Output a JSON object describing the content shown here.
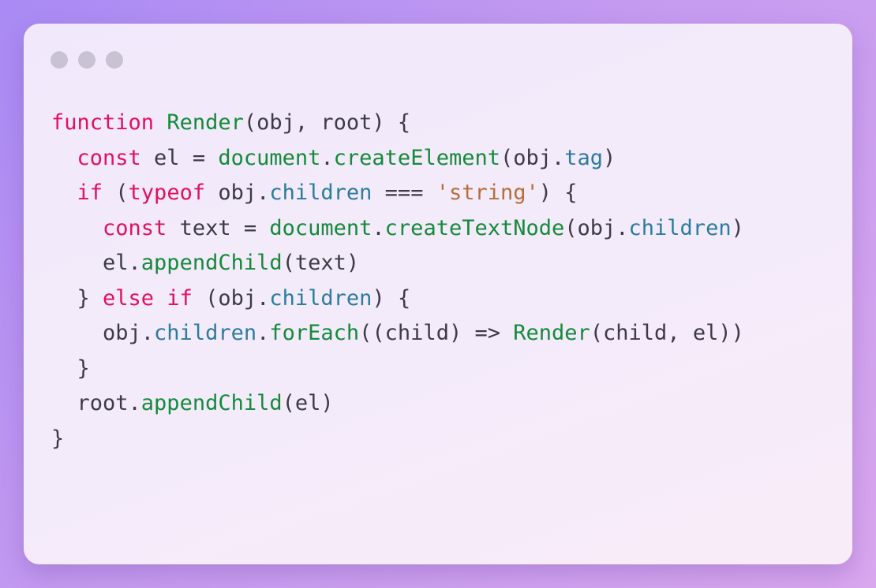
{
  "window": {
    "controls": [
      "window-dot-1",
      "window-dot-2",
      "window-dot-3"
    ]
  },
  "colors": {
    "keyword": "#e0115e",
    "function": "#148a3a",
    "property": "#2b7c9c",
    "string": "#b86e36",
    "plain": "#3d3a45",
    "background": "#f1e9fb"
  },
  "code": {
    "lines": [
      [
        [
          "kw",
          "function"
        ],
        [
          "plain",
          " "
        ],
        [
          "fn",
          "Render"
        ],
        [
          "plain",
          "(obj, root) {"
        ]
      ],
      [
        [
          "plain",
          "  "
        ],
        [
          "kw",
          "const"
        ],
        [
          "plain",
          " el = "
        ],
        [
          "fn",
          "document"
        ],
        [
          "plain",
          "."
        ],
        [
          "fn",
          "createElement"
        ],
        [
          "plain",
          "(obj."
        ],
        [
          "prop",
          "tag"
        ],
        [
          "plain",
          ")"
        ]
      ],
      [
        [
          "plain",
          "  "
        ],
        [
          "kw",
          "if"
        ],
        [
          "plain",
          " ("
        ],
        [
          "kw",
          "typeof"
        ],
        [
          "plain",
          " obj."
        ],
        [
          "prop",
          "children"
        ],
        [
          "plain",
          " === "
        ],
        [
          "str",
          "'string'"
        ],
        [
          "plain",
          ") {"
        ]
      ],
      [
        [
          "plain",
          "    "
        ],
        [
          "kw",
          "const"
        ],
        [
          "plain",
          " text = "
        ],
        [
          "fn",
          "document"
        ],
        [
          "plain",
          "."
        ],
        [
          "fn",
          "createTextNode"
        ],
        [
          "plain",
          "(obj."
        ],
        [
          "prop",
          "children"
        ],
        [
          "plain",
          ")"
        ]
      ],
      [
        [
          "plain",
          "    el."
        ],
        [
          "fn",
          "appendChild"
        ],
        [
          "plain",
          "(text)"
        ]
      ],
      [
        [
          "plain",
          "  } "
        ],
        [
          "kw",
          "else"
        ],
        [
          "plain",
          " "
        ],
        [
          "kw",
          "if"
        ],
        [
          "plain",
          " (obj."
        ],
        [
          "prop",
          "children"
        ],
        [
          "plain",
          ") {"
        ]
      ],
      [
        [
          "plain",
          "    obj."
        ],
        [
          "prop",
          "children"
        ],
        [
          "plain",
          "."
        ],
        [
          "fn",
          "forEach"
        ],
        [
          "plain",
          "((child) => "
        ],
        [
          "fn",
          "Render"
        ],
        [
          "plain",
          "(child, el))"
        ]
      ],
      [
        [
          "plain",
          "  }"
        ]
      ],
      [
        [
          "plain",
          "  root."
        ],
        [
          "fn",
          "appendChild"
        ],
        [
          "plain",
          "(el)"
        ]
      ],
      [
        [
          "plain",
          "}"
        ]
      ]
    ]
  }
}
